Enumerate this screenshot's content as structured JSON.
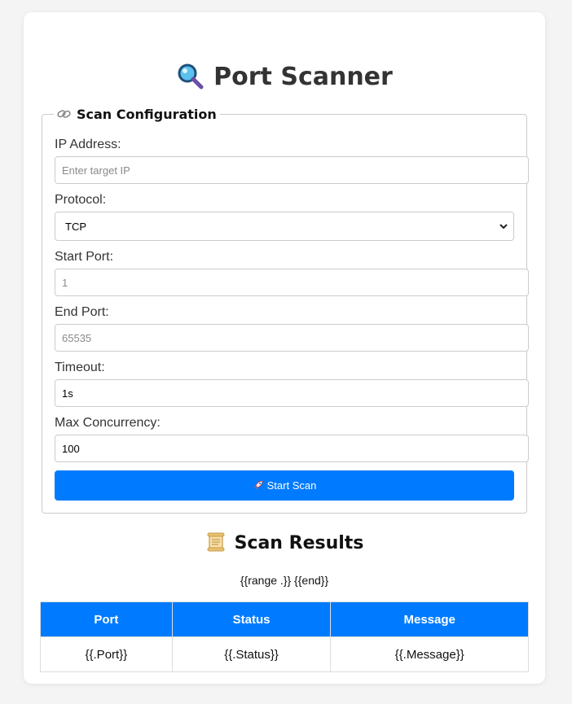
{
  "header": {
    "title": "Port Scanner",
    "icon": "magnifier-icon"
  },
  "config": {
    "legend": "Scan Configuration",
    "legend_icon": "link-icon",
    "ip": {
      "label": "IP Address:",
      "placeholder": "Enter target IP",
      "value": ""
    },
    "protocol": {
      "label": "Protocol:",
      "value": "TCP",
      "options": [
        "TCP"
      ]
    },
    "start_port": {
      "label": "Start Port:",
      "placeholder": "1",
      "value": ""
    },
    "end_port": {
      "label": "End Port:",
      "placeholder": "65535",
      "value": ""
    },
    "timeout": {
      "label": "Timeout:",
      "value": "1s"
    },
    "concurrency": {
      "label": "Max Concurrency:",
      "value": "100"
    },
    "start_button": {
      "label": "Start Scan",
      "icon": "rocket-icon"
    }
  },
  "results": {
    "title": "Scan Results",
    "title_icon": "scroll-icon",
    "range_text": "{{range .}} {{end}}",
    "columns": [
      "Port",
      "Status",
      "Message"
    ],
    "rows": [
      [
        "{{.Port}}",
        "{{.Status}}",
        "{{.Message}}"
      ]
    ]
  },
  "colors": {
    "accent": "#007bff",
    "background": "#f4f4f4",
    "card": "#ffffff"
  }
}
